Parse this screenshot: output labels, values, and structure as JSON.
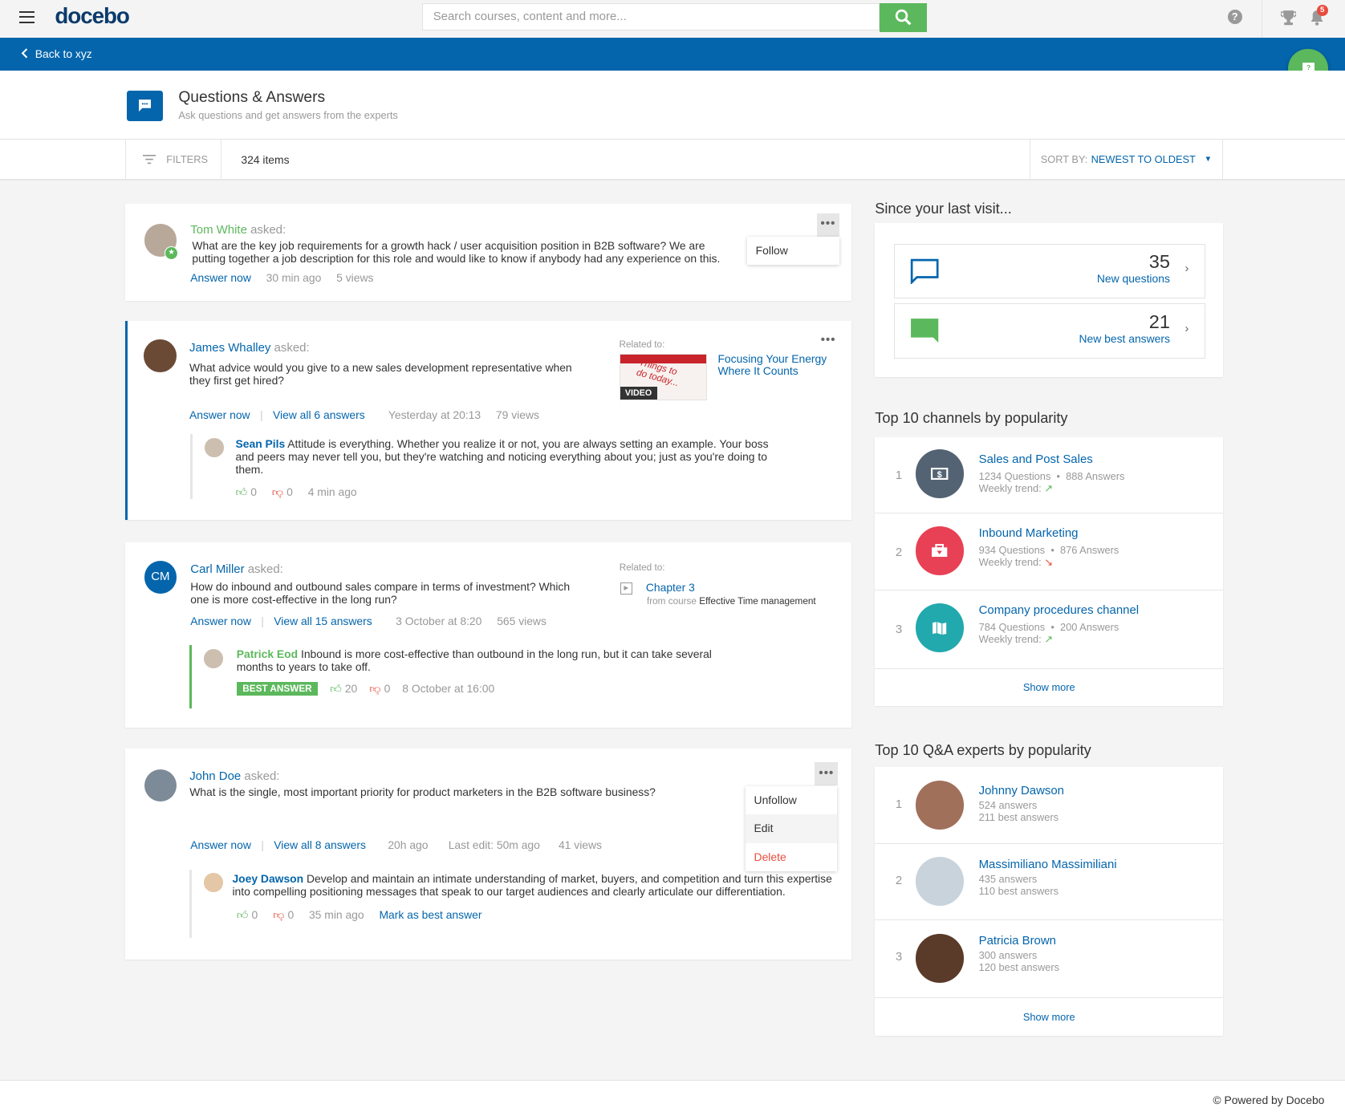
{
  "header": {
    "logo": "docebo",
    "search_placeholder": "Search courses, content and more...",
    "help_icon": "?",
    "notifications_count": "5"
  },
  "back": {
    "label": "Back to xyz"
  },
  "page": {
    "title": "Questions & Answers",
    "subtitle": "Ask questions and get answers from the experts"
  },
  "filters": {
    "label": "FILTERS",
    "items_count": "324 items",
    "sort_label": "SORT BY:",
    "sort_value": "NEWEST TO OLDEST"
  },
  "questions": [
    {
      "author": "Tom White",
      "asked": "asked:",
      "text": "What are the key job requirements for a growth hack / user acquisition position in B2B software? We are putting together a job description for this role and would like to know if anybody had any experience on this.",
      "answer_now": "Answer now",
      "time": "30 min ago",
      "views": "5 views",
      "menu": [
        "Follow"
      ]
    },
    {
      "author": "James Whalley",
      "asked": "asked:",
      "text": "What advice would you give to a new sales development representative when they first get hired?",
      "answer_now": "Answer now",
      "view_all": "View all 6 answers",
      "time": "Yesterday at 20:13",
      "views": "79 views",
      "related_label": "Related to:",
      "related_title": "Focusing Your Energy Where It Counts",
      "related_badge": "VIDEO",
      "related_thumb_text": "Things to do today...",
      "answer": {
        "author": "Sean Pils",
        "text": "Attitude is everything. Whether you realize it or not, you are always setting an example. Your boss and peers may never tell you, but they're watching and noticing everything about you; just as you're doing to them.",
        "likes": "0",
        "dislikes": "0",
        "time": "4 min ago"
      }
    },
    {
      "author": "Carl Miller",
      "initials": "CM",
      "asked": "asked:",
      "text": "How do inbound and outbound sales compare in terms of investment? Which one is more cost-effective in the long run?",
      "answer_now": "Answer now",
      "view_all": "View all 15 answers",
      "time": "3 October at 8:20",
      "views": "565 views",
      "related_label": "Related to:",
      "related_title": "Chapter 3",
      "related_from": "from course",
      "related_course": "Effective Time management",
      "answer": {
        "author": "Patrick Eod",
        "text": "Inbound is more cost-effective than outbound in the long run, but it can take several months to years to take off.",
        "best": "BEST ANSWER",
        "likes": "20",
        "dislikes": "0",
        "time": "8 October at 16:00"
      }
    },
    {
      "author": "John Doe",
      "asked": "asked:",
      "text": "What is the single, most important priority for product marketers in the B2B software business?",
      "answer_now": "Answer now",
      "view_all": "View all 8 answers",
      "time": "20h ago",
      "last_edit": "Last edit: 50m ago",
      "views": "41 views",
      "menu": [
        "Unfollow",
        "Edit",
        "Delete"
      ],
      "answer": {
        "author": "Joey Dawson",
        "text": "Develop and maintain an intimate understanding of market, buyers, and competition and turn this expertise into compelling positioning messages that speak to our target audiences and clearly articulate our differentiation.",
        "likes": "0",
        "dislikes": "0",
        "time": "35 min ago",
        "mark_best": "Mark as best answer"
      }
    }
  ],
  "since": {
    "title": "Since your last visit...",
    "stats": [
      {
        "value": "35",
        "label": "New questions"
      },
      {
        "value": "21",
        "label": "New best answers"
      }
    ]
  },
  "channels": {
    "title": "Top 10 channels by popularity",
    "trend_label": "Weekly trend:",
    "items": [
      {
        "rank": "1",
        "name": "Sales and Post Sales",
        "questions": "1234 Questions",
        "answers": "888 Answers",
        "trend": "up",
        "color": "#546373"
      },
      {
        "rank": "2",
        "name": "Inbound Marketing",
        "questions": "934 Questions",
        "answers": "876 Answers",
        "trend": "down",
        "color": "#e84055"
      },
      {
        "rank": "3",
        "name": "Company procedures channel",
        "questions": "784 Questions",
        "answers": "200 Answers",
        "trend": "up",
        "color": "#22a9ae"
      }
    ],
    "show_more": "Show more"
  },
  "experts": {
    "title": "Top 10 Q&A experts by popularity",
    "items": [
      {
        "rank": "1",
        "name": "Johnny Dawson",
        "answers": "524 answers",
        "best": "211 best answers"
      },
      {
        "rank": "2",
        "name": "Massimiliano Massimiliani",
        "answers": "435 answers",
        "best": "110 best answers"
      },
      {
        "rank": "3",
        "name": "Patricia Brown",
        "answers": "300 answers",
        "best": "120 best answers"
      }
    ],
    "show_more": "Show more"
  },
  "footer": {
    "text": "© Powered by Docebo"
  },
  "colors": {
    "brand_blue": "#0465ac",
    "green": "#5cb85c",
    "red": "#e84c3d"
  }
}
